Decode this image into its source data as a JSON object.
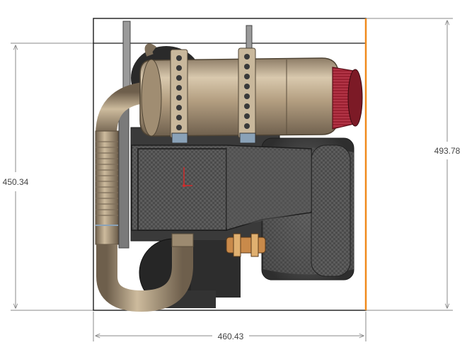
{
  "dimensions": {
    "width_label": "460.43",
    "height_left_label": "450.34",
    "height_right_label": "493.78"
  },
  "colors": {
    "background": "#ffffff",
    "bounding_box": "#1a1a1a",
    "dimension_line": "#8a8a8a",
    "highlight_edge": "#f08a1c",
    "metal_tan": "#b8a58a",
    "carbon_fiber": "#4a4a4a",
    "air_filter_red": "#b0283a",
    "engine_dark": "#2a2a2a",
    "clamp_blue": "#8aa2b8"
  },
  "icons": {
    "coordinate_axis": "axis-triad-icon"
  }
}
